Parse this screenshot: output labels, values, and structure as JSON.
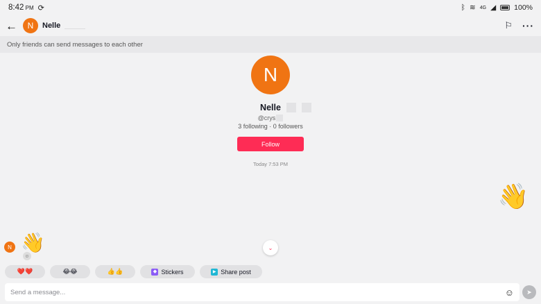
{
  "status_bar": {
    "time": "8:42",
    "ampm": "PM",
    "network": "4G",
    "battery": "100%"
  },
  "header": {
    "avatar_initial": "N",
    "name": "Nelle",
    "icons": [
      "back-arrow-icon",
      "flag-icon",
      "more-icon"
    ]
  },
  "notice": "Only friends can send messages to each other",
  "profile": {
    "avatar_initial": "N",
    "name": "Nelle",
    "handle": "@crys",
    "stats": "3 following · 0 followers",
    "follow_label": "Follow"
  },
  "timestamp": "Today 7:53 PM",
  "messages": [
    {
      "side": "right",
      "content": "👋"
    },
    {
      "side": "left",
      "avatar_initial": "N",
      "content": "👋"
    }
  ],
  "quick_replies": {
    "hearts": "❤️❤️",
    "laughs": "😂😂",
    "thumbs": "👍👍",
    "stickers": "Stickers",
    "share_post": "Share post"
  },
  "composer": {
    "placeholder": "Send a message..."
  },
  "colors": {
    "accent": "#fe2c55",
    "avatar": "#f07413",
    "background": "#f2f2f3"
  }
}
